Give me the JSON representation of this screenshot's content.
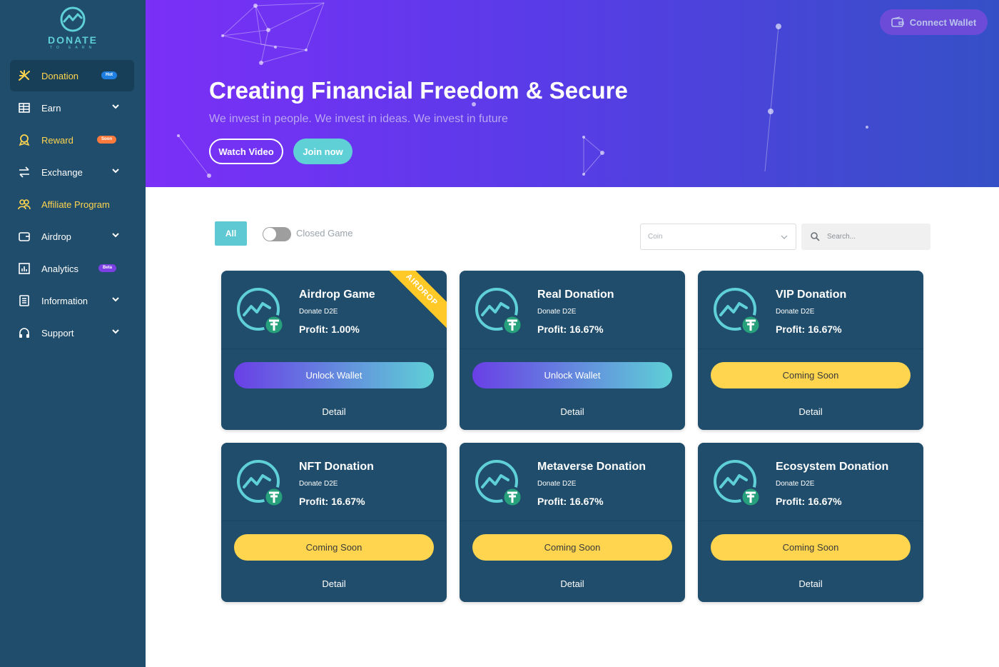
{
  "brand": {
    "name": "DONATE",
    "tagline": "TO EARN",
    "accent": "#5ed0d6"
  },
  "sidebar": {
    "items": [
      {
        "label": "Donation",
        "icon": "donation-icon",
        "badge": "Hot",
        "active": true,
        "highlight": true
      },
      {
        "label": "Earn",
        "icon": "earn-icon",
        "has_submenu": true
      },
      {
        "label": "Reward",
        "icon": "reward-icon",
        "badge": "Soon",
        "highlight": true
      },
      {
        "label": "Exchange",
        "icon": "exchange-icon",
        "has_submenu": true
      },
      {
        "label": "Affiliate Program",
        "icon": "affiliate-icon",
        "highlight": true
      },
      {
        "label": "Airdrop",
        "icon": "airdrop-icon",
        "has_submenu": true
      },
      {
        "label": "Analytics",
        "icon": "analytics-icon",
        "badge": "Beta"
      },
      {
        "label": "Information",
        "icon": "information-icon",
        "has_submenu": true
      },
      {
        "label": "Support",
        "icon": "support-icon",
        "has_submenu": true
      }
    ]
  },
  "header": {
    "connect_label": "Connect Wallet",
    "title": "Creating Financial Freedom & Secure",
    "subtitle": "We invest in people. We invest in ideas. We invest in future",
    "watch_label": "Watch Video",
    "join_label": "Join now"
  },
  "filters": {
    "all_label": "All",
    "closed_label": "Closed Game",
    "closed_on": false,
    "coin_placeholder": "Coin",
    "search_placeholder": "Search..."
  },
  "cards": [
    {
      "title": "Airdrop Game",
      "subtitle": "Donate D2E",
      "profit": "Profit: 1.00%",
      "action": "Unlock Wallet",
      "action_type": "unlock",
      "detail": "Detail",
      "ribbon": "AIRDROP"
    },
    {
      "title": "Real Donation",
      "subtitle": "Donate D2E",
      "profit": "Profit: 16.67%",
      "action": "Unlock Wallet",
      "action_type": "unlock",
      "detail": "Detail"
    },
    {
      "title": "VIP Donation",
      "subtitle": "Donate D2E",
      "profit": "Profit: 16.67%",
      "action": "Coming Soon",
      "action_type": "soon",
      "detail": "Detail"
    },
    {
      "title": "NFT Donation",
      "subtitle": "Donate D2E",
      "profit": "Profit: 16.67%",
      "action": "Coming Soon",
      "action_type": "soon",
      "detail": "Detail"
    },
    {
      "title": "Metaverse Donation",
      "subtitle": "Donate D2E",
      "profit": "Profit: 16.67%",
      "action": "Coming Soon",
      "action_type": "soon",
      "detail": "Detail"
    },
    {
      "title": "Ecosystem Donation",
      "subtitle": "Donate D2E",
      "profit": "Profit: 16.67%",
      "action": "Coming Soon",
      "action_type": "soon",
      "detail": "Detail"
    }
  ],
  "colors": {
    "sidebar_bg": "#1f4d6b",
    "card_bg": "#1f4d6b",
    "highlight": "#ffd54f",
    "coming_soon": "#ffd54f",
    "teal": "#5ed0d6",
    "tether": "#26a17b"
  }
}
